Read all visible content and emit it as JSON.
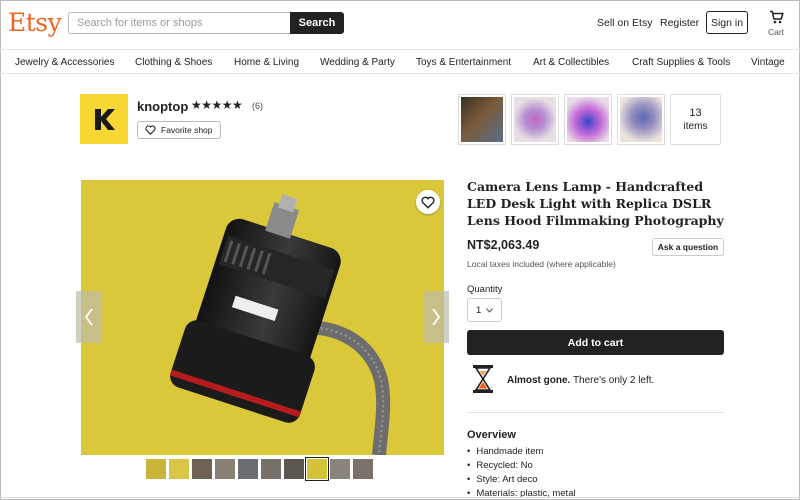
{
  "header": {
    "logo": "Etsy",
    "search_placeholder": "Search for items or shops",
    "search_button": "Search",
    "sell_link": "Sell on Etsy",
    "register_link": "Register",
    "signin_button": "Sign in",
    "cart_label": "Cart"
  },
  "categories": [
    "Jewelry & Accessories",
    "Clothing & Shoes",
    "Home & Living",
    "Wedding & Party",
    "Toys & Entertainment",
    "Art & Collectibles",
    "Craft Supplies & Tools",
    "Vintage"
  ],
  "shop": {
    "name": "knoptop",
    "stars": "★★★★★",
    "rating": 5,
    "review_count": "(6)",
    "favorite_label": "Favorite shop",
    "items_count": "13",
    "items_label": "items"
  },
  "listing": {
    "title": "Camera Lens Lamp - Handcrafted LED Desk Light with Replica DSLR Lens Hood Filmmaking Photography",
    "price": "NT$2,063.49",
    "ask_question": "Ask a question",
    "tax_note": "Local taxes included (where applicable)",
    "quantity_label": "Quantity",
    "quantity_value": "1",
    "add_to_cart": "Add to cart",
    "scarcity_bold": "Almost gone.",
    "scarcity_text": " There's only 2 left.",
    "overview_heading": "Overview",
    "overview_items": [
      "Handmade item",
      "Recycled: No",
      "Style: Art deco",
      "Materials: plastic, metal"
    ]
  },
  "colors": {
    "brand": "#f1641e",
    "photo_yellow": "#dac73a"
  },
  "icons": [
    "cart-icon",
    "heart-icon",
    "hourglass-icon",
    "chevron-left-icon",
    "chevron-right-icon",
    "chevron-down-icon",
    "shop-logo-k-icon"
  ]
}
